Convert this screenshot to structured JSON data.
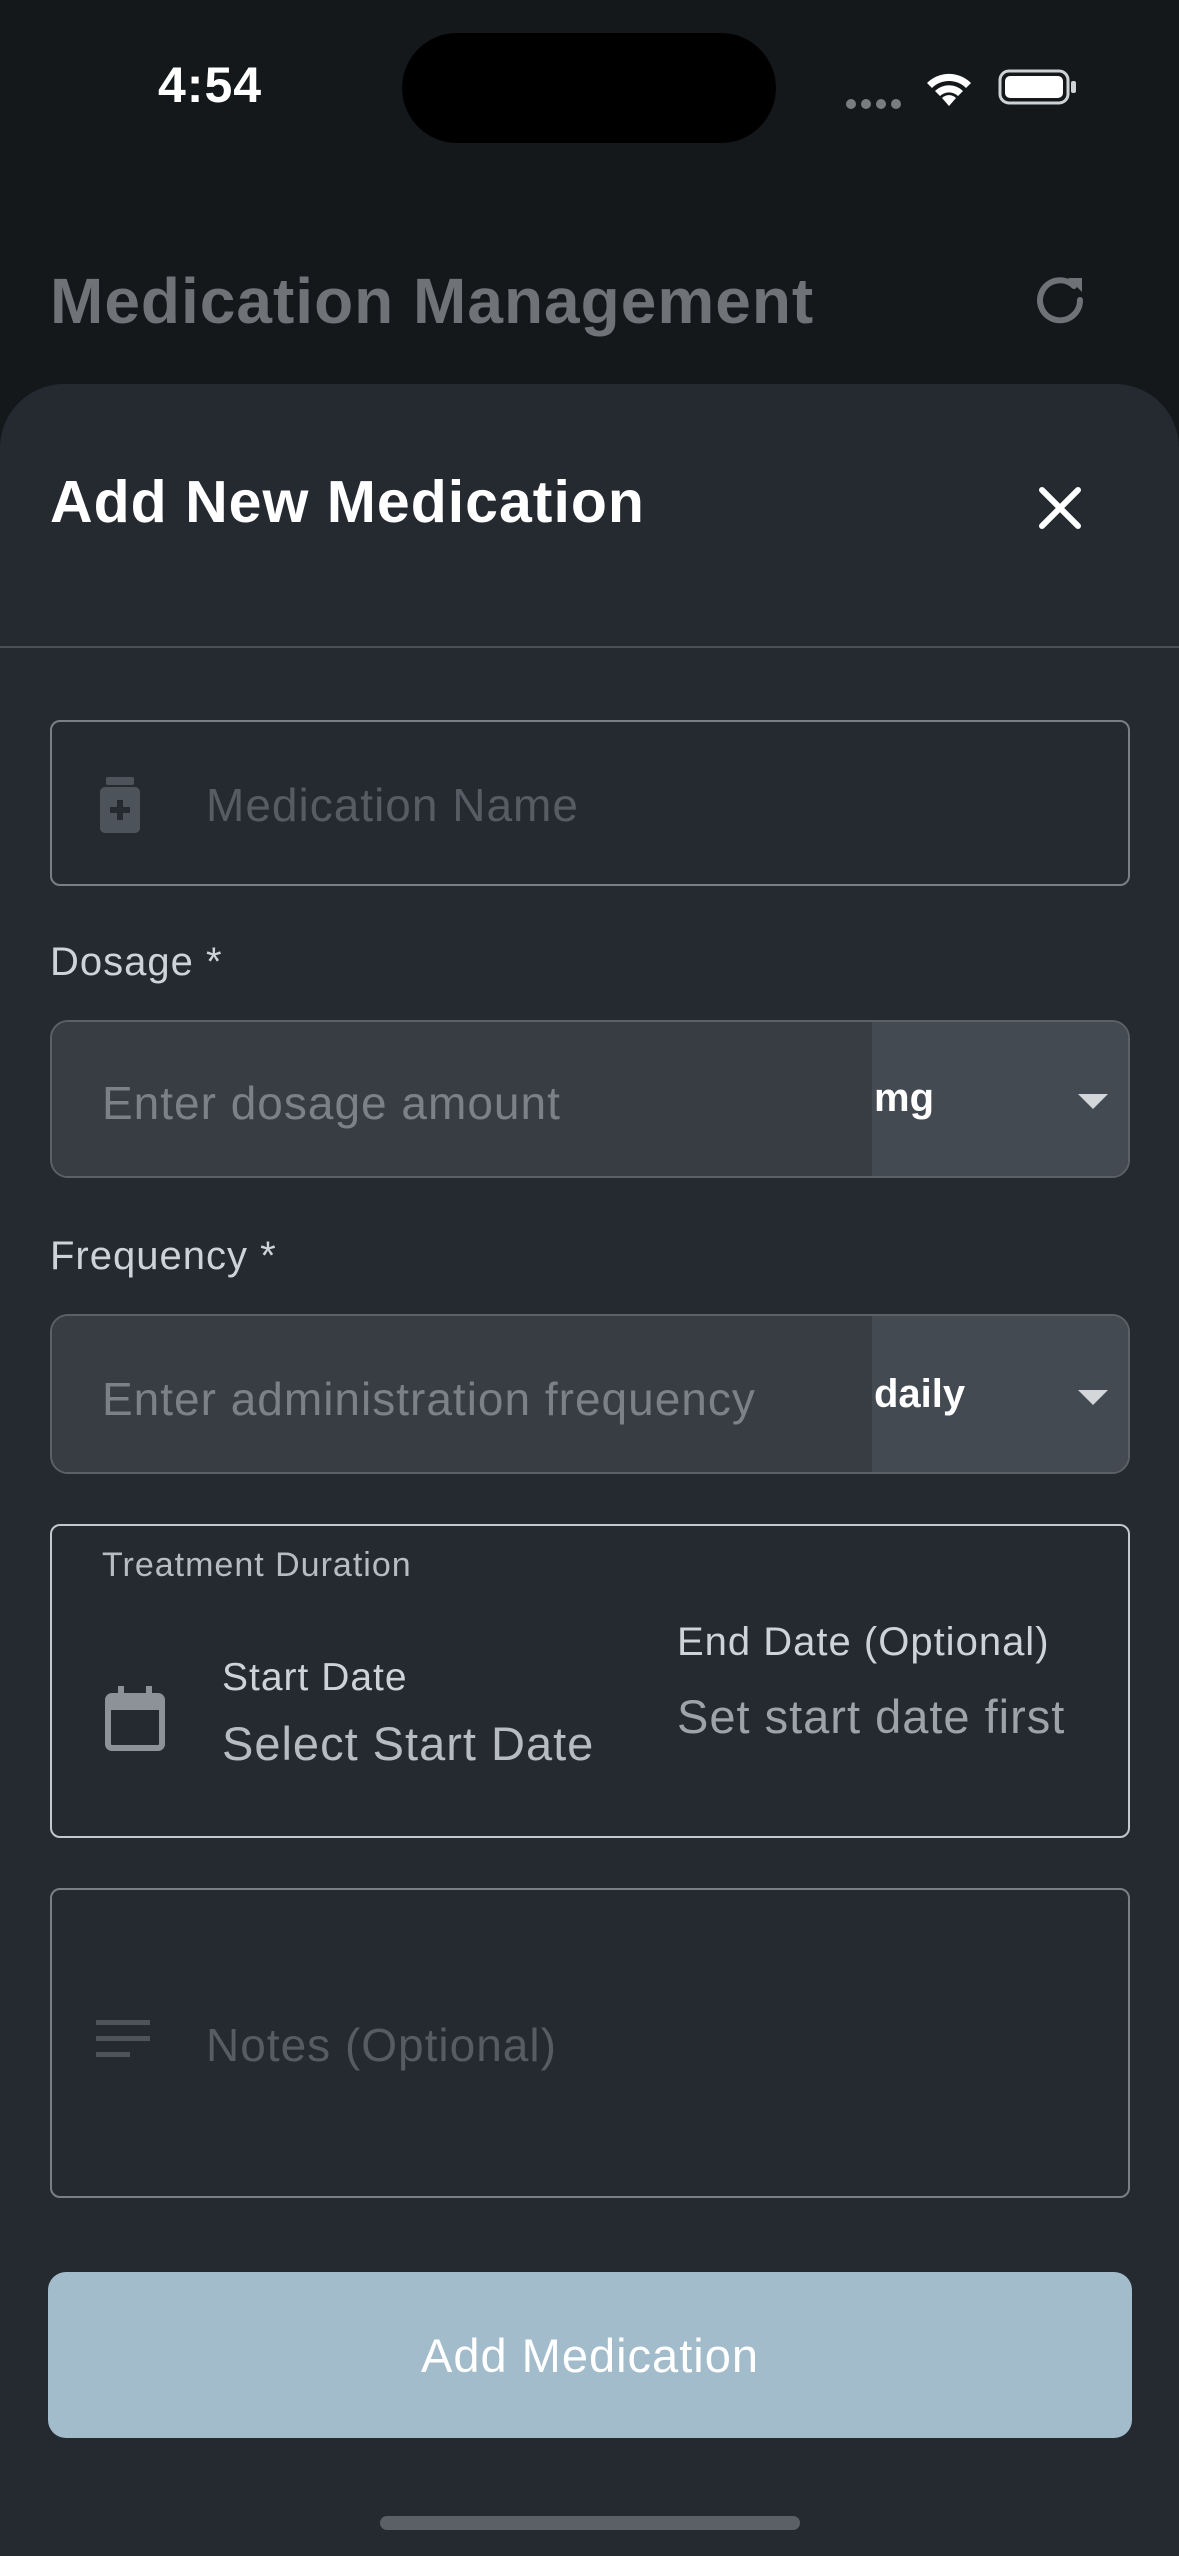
{
  "status_bar": {
    "time": "4:54"
  },
  "app_header": {
    "title": "Medication Management"
  },
  "sheet": {
    "title": "Add New Medication",
    "medication_name": {
      "placeholder": "Medication Name"
    },
    "dosage": {
      "label": "Dosage *",
      "placeholder": "Enter dosage amount",
      "unit": "mg"
    },
    "frequency": {
      "label": "Frequency *",
      "placeholder": "Enter administration frequency",
      "unit": "daily"
    },
    "duration": {
      "title": "Treatment Duration",
      "start_label": "Start Date",
      "start_value": "Select Start Date",
      "end_label": "End Date (Optional)",
      "end_value": "Set start date first"
    },
    "notes": {
      "placeholder": "Notes (Optional)"
    },
    "submit_label": "Add Medication"
  },
  "icons": {
    "status": [
      "wifi-icon",
      "battery-icon"
    ],
    "header": "refresh-icon",
    "close": "close-icon",
    "medication": "pill-bottle-icon",
    "calendar": "calendar-icon",
    "notes": "notes-lines-icon"
  },
  "colors": {
    "sheet_bg": "#252a31",
    "button_bg": "#a3bccb",
    "input_bg": "#383d44",
    "unit_bg": "#444a51"
  }
}
